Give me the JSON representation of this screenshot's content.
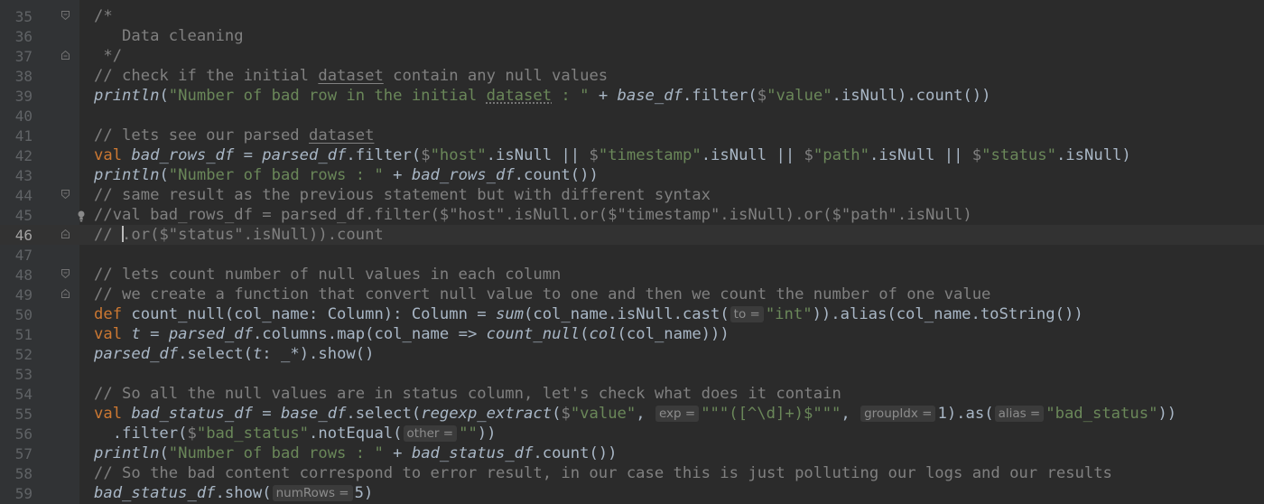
{
  "current_line": 46,
  "lines": [
    {
      "n": "35",
      "fold": "start",
      "tokens": [
        {
          "t": "/*",
          "c": "t-c"
        }
      ]
    },
    {
      "n": "36",
      "tokens": [
        {
          "t": "   Data cleaning",
          "c": "t-c"
        }
      ]
    },
    {
      "n": "37",
      "fold": "end",
      "tokens": [
        {
          "t": " */",
          "c": "t-c"
        }
      ]
    },
    {
      "n": "38",
      "tokens": [
        {
          "t": "// check if the initial ",
          "c": "t-c"
        },
        {
          "t": "dataset",
          "c": "t-c t-und"
        },
        {
          "t": " contain any null values",
          "c": "t-c"
        }
      ]
    },
    {
      "n": "39",
      "tokens": [
        {
          "t": "println",
          "c": "t-it"
        },
        {
          "t": "("
        },
        {
          "t": "\"Number of bad row in the initial ",
          "c": "t-str"
        },
        {
          "t": "dataset",
          "c": "t-str t-dotted"
        },
        {
          "t": " : \"",
          "c": "t-str"
        },
        {
          "t": " + "
        },
        {
          "t": "base_df",
          "c": "t-it"
        },
        {
          "t": ".filter("
        },
        {
          "t": "$",
          "c": "t-c"
        },
        {
          "t": "\"value\"",
          "c": "t-str"
        },
        {
          "t": ".isNull).count())"
        }
      ]
    },
    {
      "n": "40",
      "tokens": []
    },
    {
      "n": "41",
      "tokens": [
        {
          "t": "// lets see our parsed ",
          "c": "t-c"
        },
        {
          "t": "dataset",
          "c": "t-c t-und"
        }
      ]
    },
    {
      "n": "42",
      "tokens": [
        {
          "t": "val ",
          "c": "t-kw"
        },
        {
          "t": "bad_rows_df",
          "c": "t-it"
        },
        {
          "t": " = "
        },
        {
          "t": "parsed_df",
          "c": "t-it"
        },
        {
          "t": ".filter("
        },
        {
          "t": "$",
          "c": "t-c"
        },
        {
          "t": "\"host\"",
          "c": "t-str"
        },
        {
          "t": ".isNull || "
        },
        {
          "t": "$",
          "c": "t-c"
        },
        {
          "t": "\"timestamp\"",
          "c": "t-str"
        },
        {
          "t": ".isNull || "
        },
        {
          "t": "$",
          "c": "t-c"
        },
        {
          "t": "\"path\"",
          "c": "t-str"
        },
        {
          "t": ".isNull || "
        },
        {
          "t": "$",
          "c": "t-c"
        },
        {
          "t": "\"status\"",
          "c": "t-str"
        },
        {
          "t": ".isNull)"
        }
      ]
    },
    {
      "n": "43",
      "tokens": [
        {
          "t": "println",
          "c": "t-it"
        },
        {
          "t": "("
        },
        {
          "t": "\"Number of bad rows : \"",
          "c": "t-str"
        },
        {
          "t": " + "
        },
        {
          "t": "bad_rows_df",
          "c": "t-it"
        },
        {
          "t": ".count())"
        }
      ]
    },
    {
      "n": "44",
      "fold": "start",
      "tokens": [
        {
          "t": "// same result as the previous statement but with different syntax",
          "c": "t-c"
        }
      ]
    },
    {
      "n": "45",
      "bulb": true,
      "tokens": [
        {
          "t": "//val bad_rows_df = parsed_df.filter($\"host\".isNull.or($\"timestamp\".isNull).or($\"path\".isNull)",
          "c": "t-c"
        }
      ]
    },
    {
      "n": "46",
      "fold": "end",
      "caret": true,
      "tokens": [
        {
          "t": "// ",
          "c": "t-c"
        },
        {
          "t": "CARET",
          "c": "caret"
        },
        {
          "t": ".or($\"status\".isNull)).count",
          "c": "t-c"
        }
      ]
    },
    {
      "n": "47",
      "tokens": []
    },
    {
      "n": "48",
      "fold": "start",
      "tokens": [
        {
          "t": "// lets count number of null values in each column",
          "c": "t-c"
        }
      ]
    },
    {
      "n": "49",
      "fold": "end",
      "tokens": [
        {
          "t": "// we create a function that convert null value to one and then we count the number of one value",
          "c": "t-c"
        }
      ]
    },
    {
      "n": "50",
      "tokens": [
        {
          "t": "def ",
          "c": "t-kw"
        },
        {
          "t": "count_null(col_name: Column): Column = "
        },
        {
          "t": "sum",
          "c": "t-it"
        },
        {
          "t": "(col_name.isNull.cast("
        },
        {
          "t": "to =",
          "c": "hint"
        },
        {
          "t": "\"int\"",
          "c": "t-str"
        },
        {
          "t": ")).alias(col_name.toString())"
        }
      ]
    },
    {
      "n": "51",
      "tokens": [
        {
          "t": "val ",
          "c": "t-kw"
        },
        {
          "t": "t",
          "c": "t-it"
        },
        {
          "t": " = "
        },
        {
          "t": "parsed_df",
          "c": "t-it"
        },
        {
          "t": ".columns.map(col_name => "
        },
        {
          "t": "count_null",
          "c": "t-it"
        },
        {
          "t": "("
        },
        {
          "t": "col",
          "c": "t-it"
        },
        {
          "t": "(col_name)))"
        }
      ]
    },
    {
      "n": "52",
      "tokens": [
        {
          "t": "parsed_df",
          "c": "t-it"
        },
        {
          "t": ".select("
        },
        {
          "t": "t",
          "c": "t-it"
        },
        {
          "t": ": _*).show()"
        }
      ]
    },
    {
      "n": "53",
      "tokens": []
    },
    {
      "n": "54",
      "tokens": [
        {
          "t": "// So all the null values are in status column, let's check what does it contain",
          "c": "t-c"
        }
      ]
    },
    {
      "n": "55",
      "tokens": [
        {
          "t": "val ",
          "c": "t-kw"
        },
        {
          "t": "bad_status_df",
          "c": "t-it"
        },
        {
          "t": " = "
        },
        {
          "t": "base_df",
          "c": "t-it"
        },
        {
          "t": ".select("
        },
        {
          "t": "regexp_extract",
          "c": "t-it"
        },
        {
          "t": "("
        },
        {
          "t": "$",
          "c": "t-c"
        },
        {
          "t": "\"value\"",
          "c": "t-str"
        },
        {
          "t": ", "
        },
        {
          "t": "exp =",
          "c": "hint"
        },
        {
          "t": "\"\"\"([^\\d]+)$\"\"\"",
          "c": "t-str"
        },
        {
          "t": ", "
        },
        {
          "t": "groupIdx =",
          "c": "hint"
        },
        {
          "t": "1).as("
        },
        {
          "t": "alias =",
          "c": "hint"
        },
        {
          "t": "\"bad_status\"",
          "c": "t-str"
        },
        {
          "t": "))"
        }
      ]
    },
    {
      "n": "56",
      "tokens": [
        {
          "t": "  .filter("
        },
        {
          "t": "$",
          "c": "t-c"
        },
        {
          "t": "\"bad_status\"",
          "c": "t-str"
        },
        {
          "t": ".notEqual("
        },
        {
          "t": "other =",
          "c": "hint"
        },
        {
          "t": "\"\"",
          "c": "t-str"
        },
        {
          "t": "))"
        }
      ]
    },
    {
      "n": "57",
      "tokens": [
        {
          "t": "println",
          "c": "t-it"
        },
        {
          "t": "("
        },
        {
          "t": "\"Number of bad rows : \"",
          "c": "t-str"
        },
        {
          "t": " + "
        },
        {
          "t": "bad_status_df",
          "c": "t-it"
        },
        {
          "t": ".count())"
        }
      ]
    },
    {
      "n": "58",
      "tokens": [
        {
          "t": "// So the bad content correspond to error result, in our case this is just polluting our logs and our results",
          "c": "t-c"
        }
      ]
    },
    {
      "n": "59",
      "tokens": [
        {
          "t": "bad_status_df",
          "c": "t-it"
        },
        {
          "t": ".show("
        },
        {
          "t": "numRows =",
          "c": "hint"
        },
        {
          "t": "5)"
        }
      ]
    }
  ]
}
